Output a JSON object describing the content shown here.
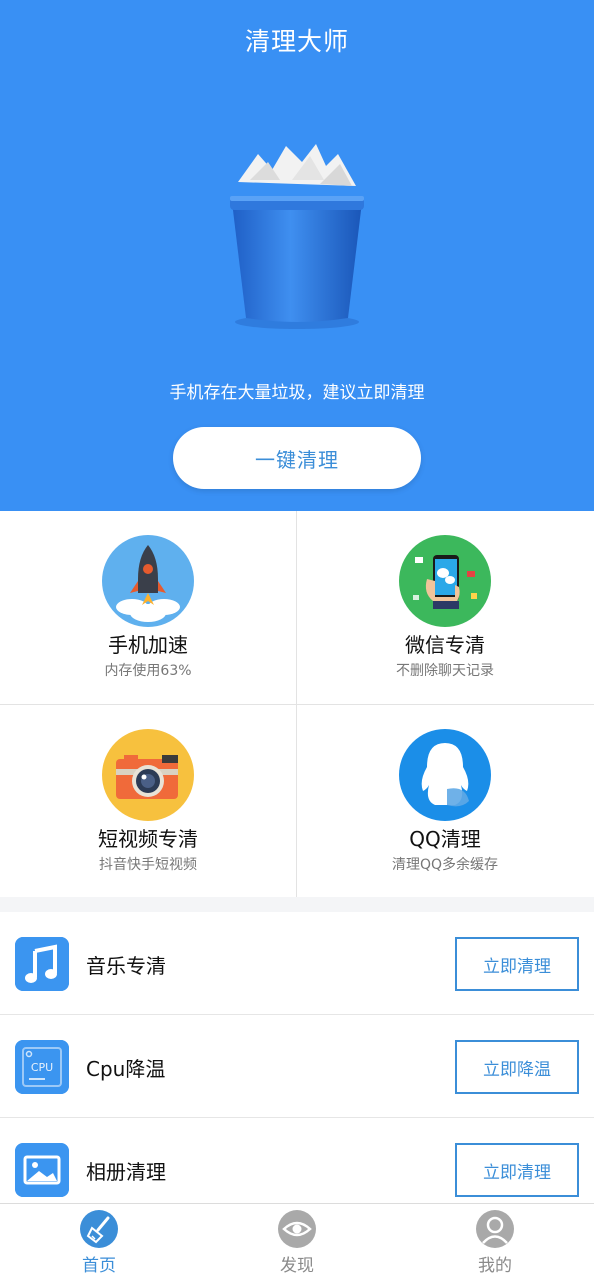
{
  "header": {
    "title": "清理大师",
    "hint": "手机存在大量垃圾，建议立即清理",
    "clean_button": "一键清理"
  },
  "features": [
    {
      "title": "手机加速",
      "subtitle": "内存使用63%",
      "icon": "rocket-icon"
    },
    {
      "title": "微信专清",
      "subtitle": "不删除聊天记录",
      "icon": "wechat-phone-icon"
    },
    {
      "title": "短视频专清",
      "subtitle": "抖音快手短视频",
      "icon": "camera-icon"
    },
    {
      "title": "QQ清理",
      "subtitle": "清理QQ多余缓存",
      "icon": "qq-penguin-icon"
    }
  ],
  "list": [
    {
      "label": "音乐专清",
      "button": "立即清理",
      "icon": "music-note-icon"
    },
    {
      "label": "Cpu降温",
      "button": "立即降温",
      "icon": "cpu-icon",
      "icon_text": "CPU"
    },
    {
      "label": "相册清理",
      "button": "立即清理",
      "icon": "photo-album-icon"
    }
  ],
  "tabs": [
    {
      "label": "首页",
      "icon": "broom-icon",
      "active": true
    },
    {
      "label": "发现",
      "icon": "eye-icon",
      "active": false
    },
    {
      "label": "我的",
      "icon": "user-icon",
      "active": false
    }
  ],
  "colors": {
    "primary": "#3990f4",
    "accent": "#3b8ed8"
  }
}
